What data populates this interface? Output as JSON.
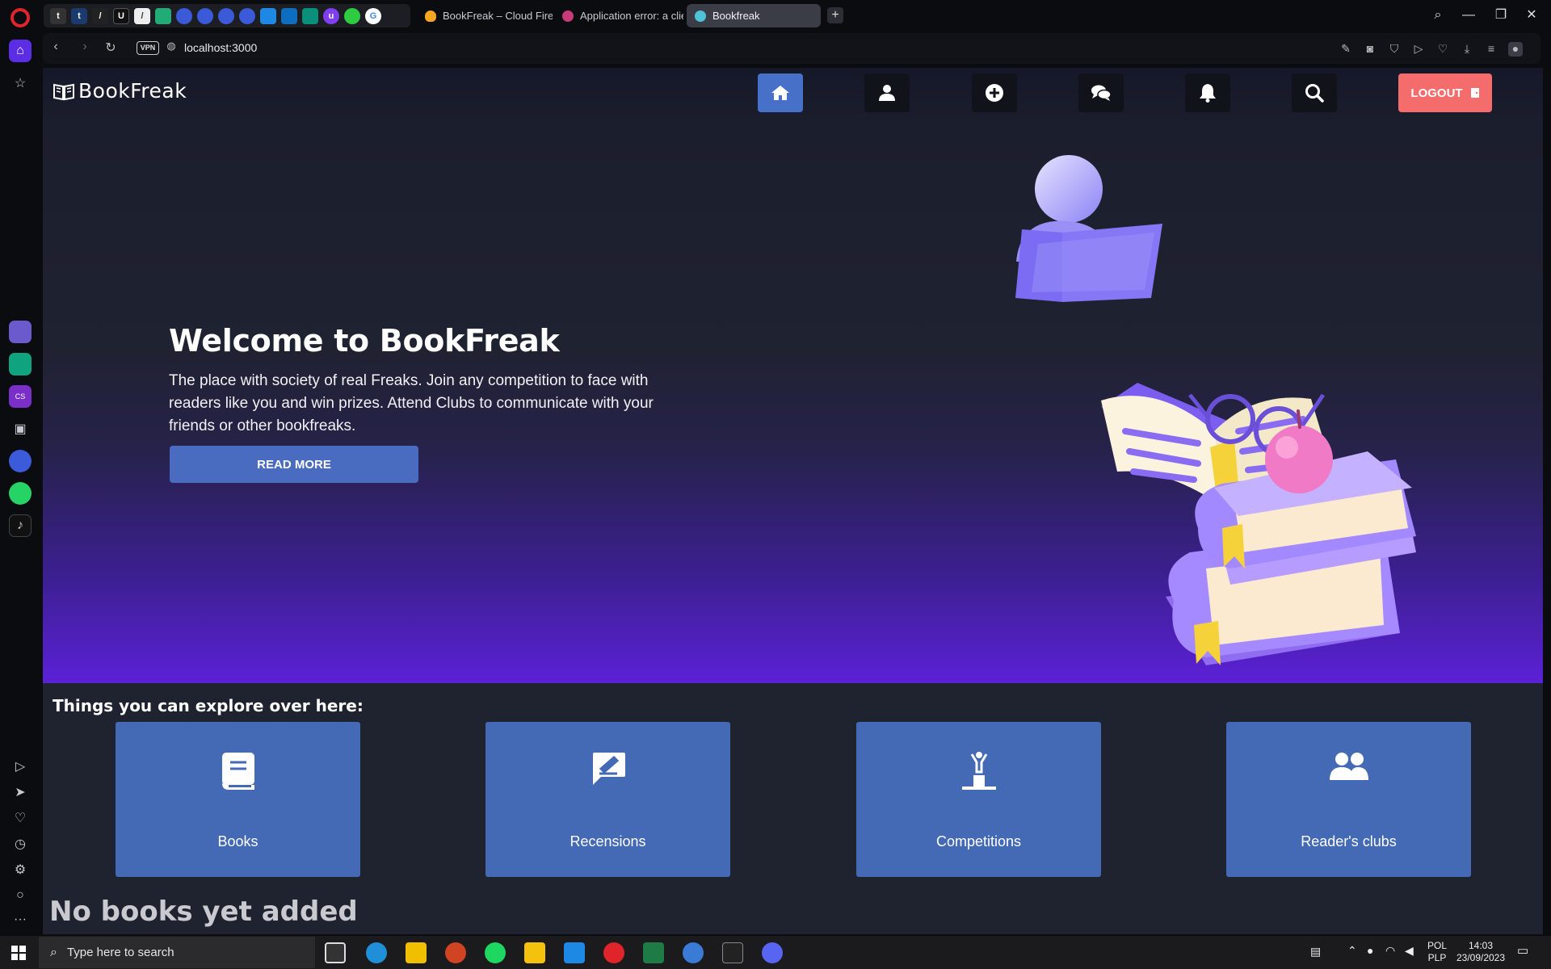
{
  "browser": {
    "tabs": [
      {
        "title": "BookFreak – Cloud Firesto",
        "favicon_color": "#f5a623"
      },
      {
        "title": "Application error: a client",
        "favicon_color": "#c93a7a"
      },
      {
        "title": "Bookfreak",
        "favicon_color": "#4fc3d8"
      }
    ],
    "url": "localhost:3000",
    "vpn_label": "VPN"
  },
  "site": {
    "logo_text_a": "Book",
    "logo_text_b": "Freak",
    "nav": [
      "home-icon",
      "user-icon",
      "plus-circle-icon",
      "comments-icon",
      "bell-icon",
      "search-icon"
    ],
    "logout_label": "LOGOUT"
  },
  "hero": {
    "title": "Welcome to BookFreak",
    "lead": "The place with society of real Freaks. Join any competition to face with readers like you and win prizes. Attend Clubs to communicate with your friends or other bookfreaks.",
    "button": "READ MORE"
  },
  "explore": {
    "title": "Things you can explore over here:",
    "cards": [
      {
        "label": "Books",
        "icon": "book-icon"
      },
      {
        "label": "Recensions",
        "icon": "review-icon"
      },
      {
        "label": "Competitions",
        "icon": "podium-icon"
      },
      {
        "label": "Reader's clubs",
        "icon": "users-icon"
      }
    ]
  },
  "empty_state": "No books yet added",
  "taskbar": {
    "search_placeholder": "Type here to search",
    "lang_top": "POL",
    "lang_bottom": "PLP",
    "time": "14:03",
    "date": "23/09/2023"
  },
  "colors": {
    "accent": "#4469b5",
    "logout": "#f56c6c",
    "hero_bottom": "#5b21d6",
    "page_bg": "#1f2330"
  }
}
